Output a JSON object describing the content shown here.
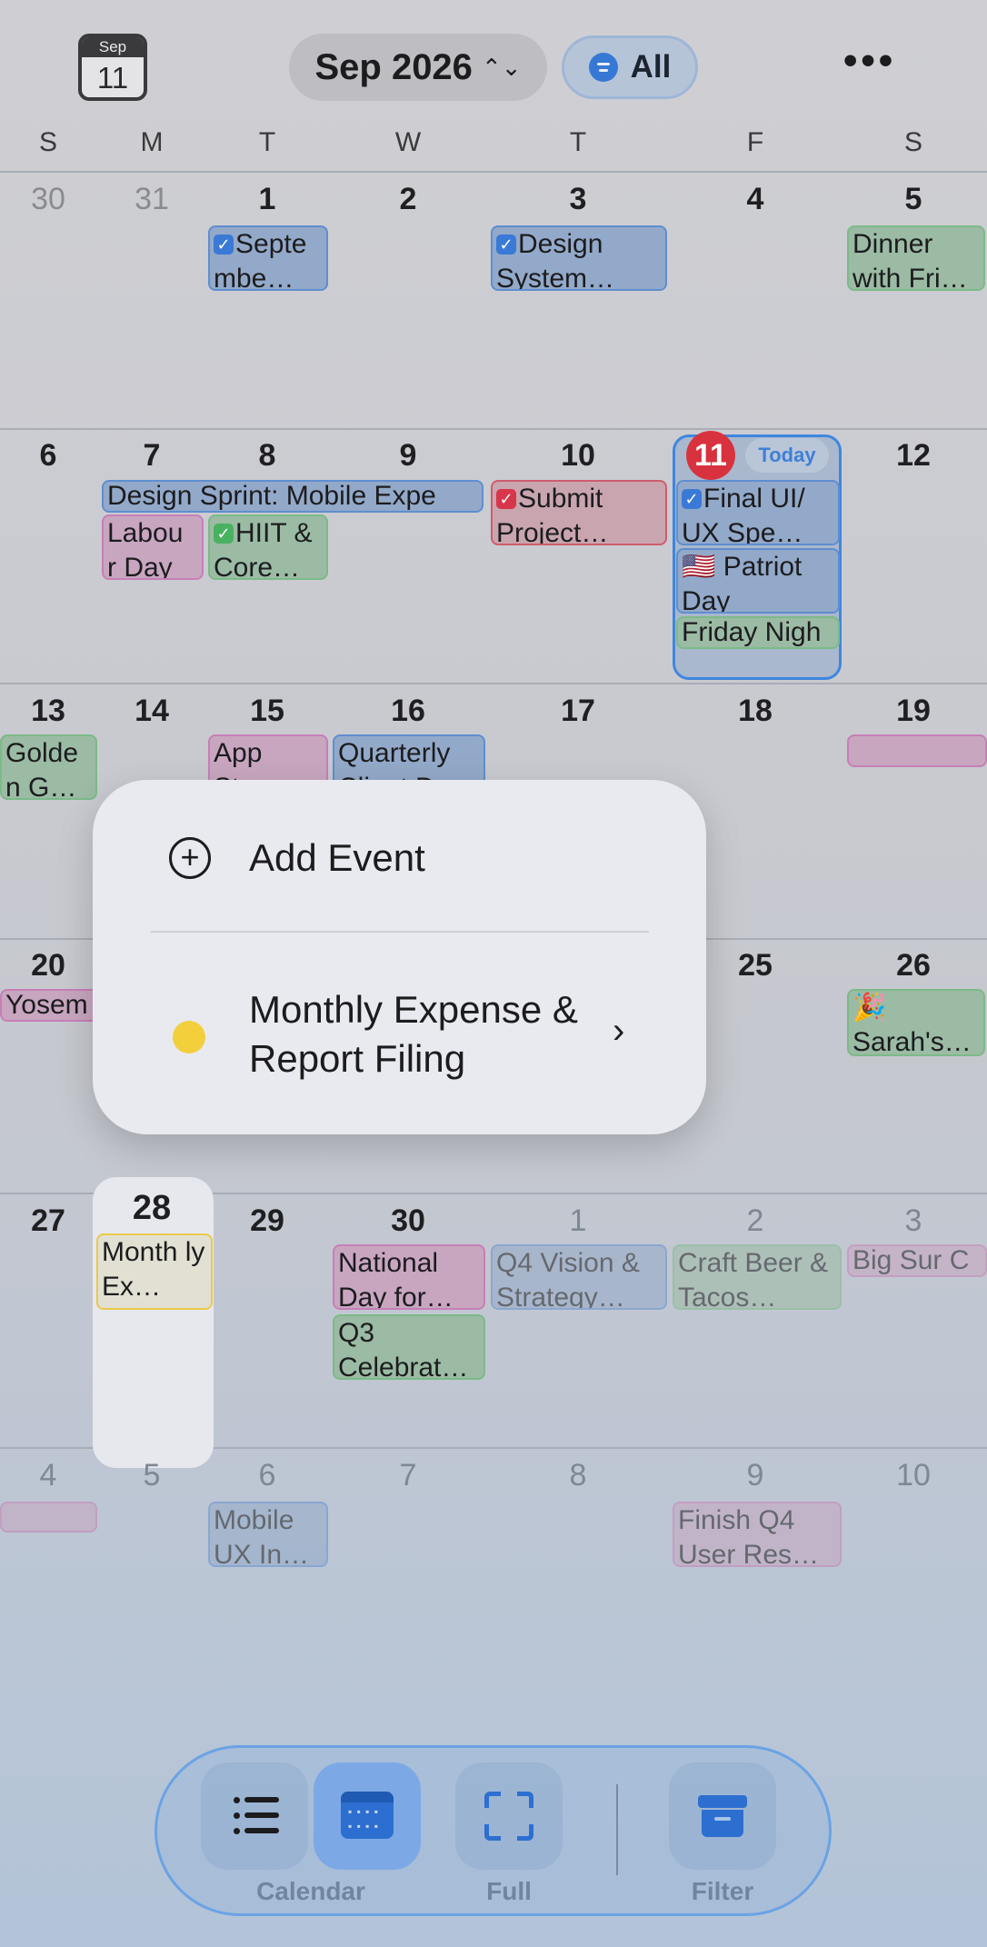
{
  "header": {
    "cal_icon_month": "Sep",
    "cal_icon_day": "11",
    "month_label": "Sep 2026",
    "filter_label": "All",
    "more_label": "•••"
  },
  "weekdays": [
    "S",
    "M",
    "T",
    "W",
    "T",
    "F",
    "S"
  ],
  "weeks": [
    [
      "30",
      "31",
      "1",
      "2",
      "3",
      "4",
      "5"
    ],
    [
      "6",
      "7",
      "8",
      "9",
      "10",
      "11",
      "12"
    ],
    [
      "13",
      "14",
      "15",
      "16",
      "17",
      "18",
      "19"
    ],
    [
      "20",
      "",
      "",
      "",
      "",
      "25",
      "26"
    ],
    [
      "27",
      "28",
      "29",
      "30",
      "1",
      "2",
      "3"
    ],
    [
      "4",
      "5",
      "6",
      "7",
      "8",
      "9",
      "10"
    ]
  ],
  "today_label": "Today",
  "events": {
    "w1_tue": "Septe mbe…",
    "w1_thu": "Design System…",
    "w1_sat": "Dinner with Fri…",
    "w2_sprint": "Design Sprint: Mobile Expe",
    "w2_mon": "Labou r Day",
    "w2_tue": "HIIT & Core…",
    "w2_thu": "Submit Project…",
    "w2_fri1": "Final UI/ UX Spe…",
    "w2_fri2": "🇺🇸 Patriot Day",
    "w2_fri3": "Friday Nigh",
    "w3_sun": "Golde n G…",
    "w3_tue": "App Sto…",
    "w3_wed": "Quarterly Client D…",
    "w4_sun": "Yosem",
    "w4_sat": "🎉 Sarah's…",
    "w5_mon": "Month ly Ex…",
    "w5_wed1": "National Day for…",
    "w5_wed2": "Q3 Celebrat…",
    "w5_thu": "Q4 Vision & Strategy…",
    "w5_fri": "Craft Beer & Tacos…",
    "w5_sat": "Big Sur C",
    "w6_tue": "Mobile UX In…",
    "w6_fri": "Finish Q4 User Res…"
  },
  "popup": {
    "add_label": "Add Event",
    "event_label": "Monthly Expense & Report Filing",
    "event_color": "#f3cf3b"
  },
  "toolbar": {
    "calendar_label": "Calendar",
    "full_label": "Full",
    "filter_label": "Filter"
  }
}
